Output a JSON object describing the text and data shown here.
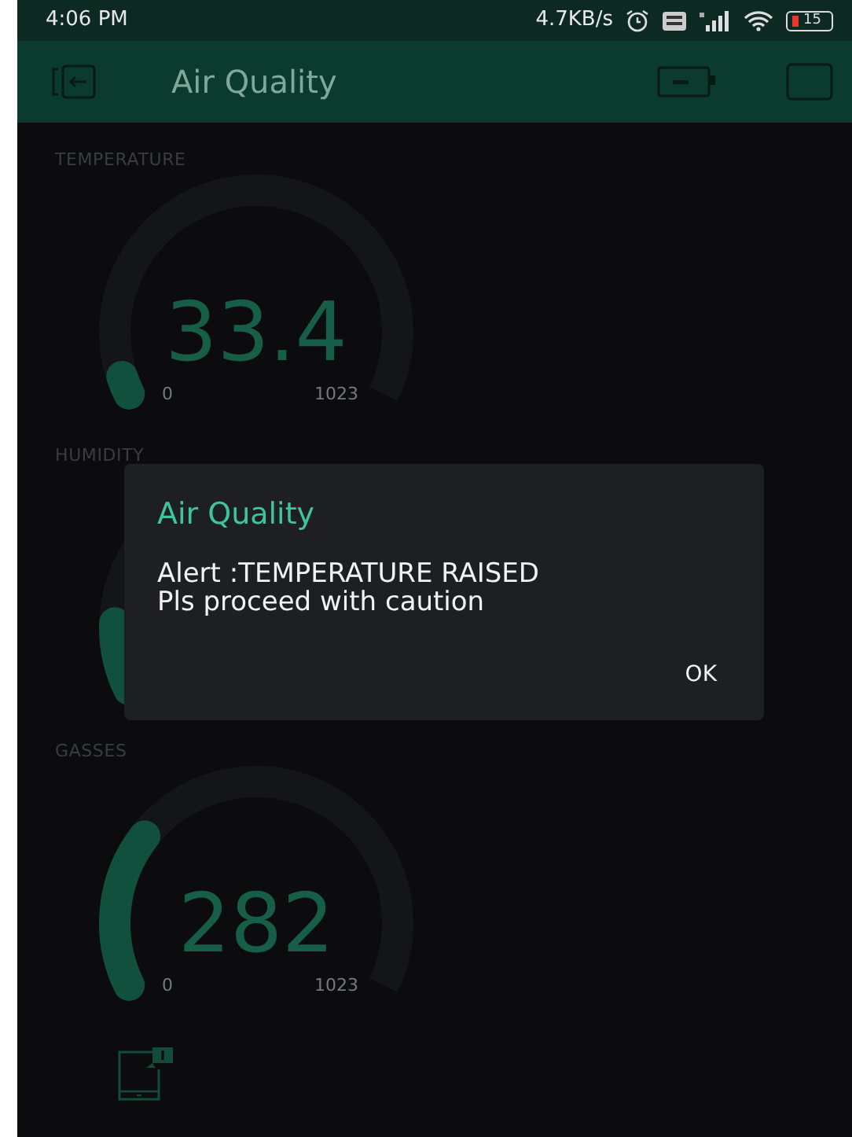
{
  "status_bar": {
    "time": "4:06 PM",
    "speed": "4.7KB/s",
    "battery": "15"
  },
  "app_bar": {
    "title": "Air Quality"
  },
  "gauges": [
    {
      "label": "TEMPERATURE",
      "value": "33.4",
      "min": "0",
      "max": "1023"
    },
    {
      "label": "HUMIDITY"
    },
    {
      "label": "GASSES",
      "value": "282",
      "min": "0",
      "max": "1023"
    }
  ],
  "dialog": {
    "title": "Air Quality",
    "message": "Alert :TEMPERATURE RAISED\nPls proceed with caution",
    "button": "OK"
  }
}
